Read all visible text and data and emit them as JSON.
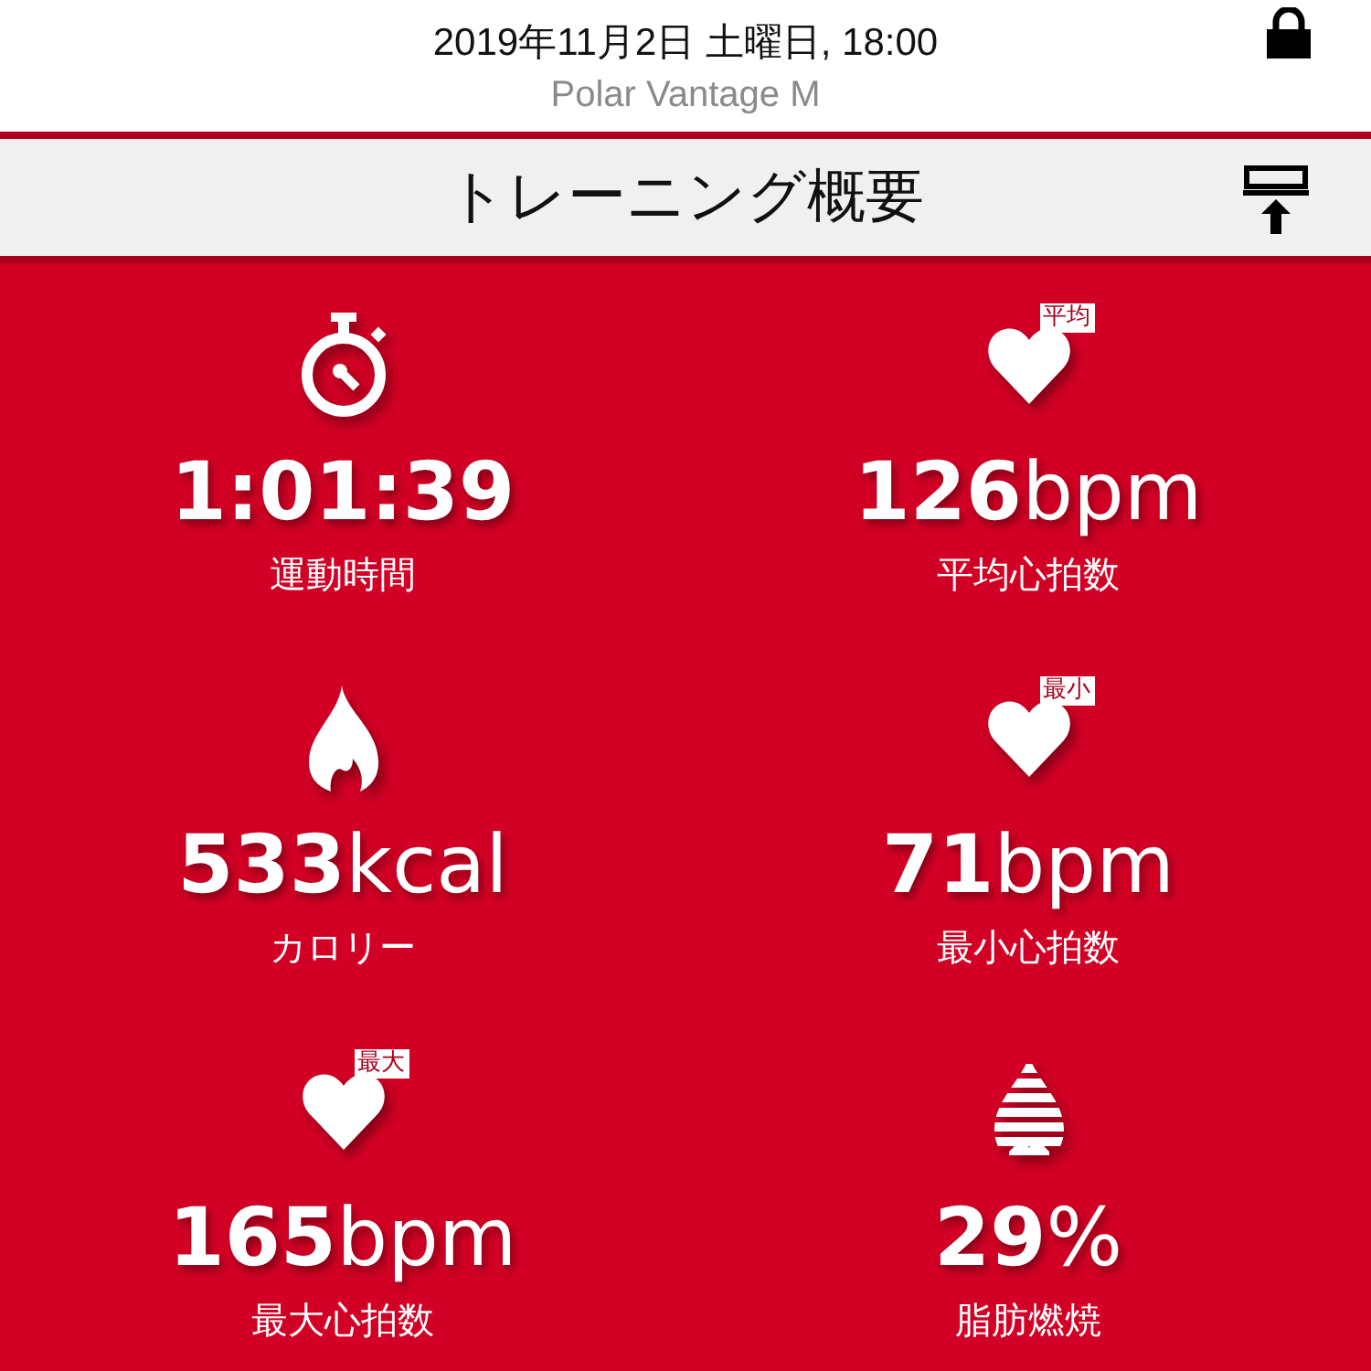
{
  "header": {
    "datetime": "2019年11月2日 土曜日, 18:00",
    "device": "Polar Vantage M",
    "locked": true
  },
  "title_bar": {
    "title": "トレーニング概要"
  },
  "stats": [
    {
      "kind": "stopwatch",
      "number": "1:01:39",
      "label": "運動時間"
    },
    {
      "kind": "heart",
      "badge": "平均",
      "number": "126",
      "unit": "bpm",
      "label": "平均心拍数"
    },
    {
      "kind": "flame",
      "number": "533",
      "unit": "kcal",
      "label": "カロリー"
    },
    {
      "kind": "heart",
      "badge": "最小",
      "number": "71",
      "unit": "bpm",
      "label": "最小心拍数"
    },
    {
      "kind": "heart",
      "badge": "最大",
      "number": "165",
      "unit": "bpm",
      "label": "最大心拍数"
    },
    {
      "kind": "fatburn",
      "number": "29",
      "unit": "%",
      "label": "脂肪燃焼"
    }
  ]
}
